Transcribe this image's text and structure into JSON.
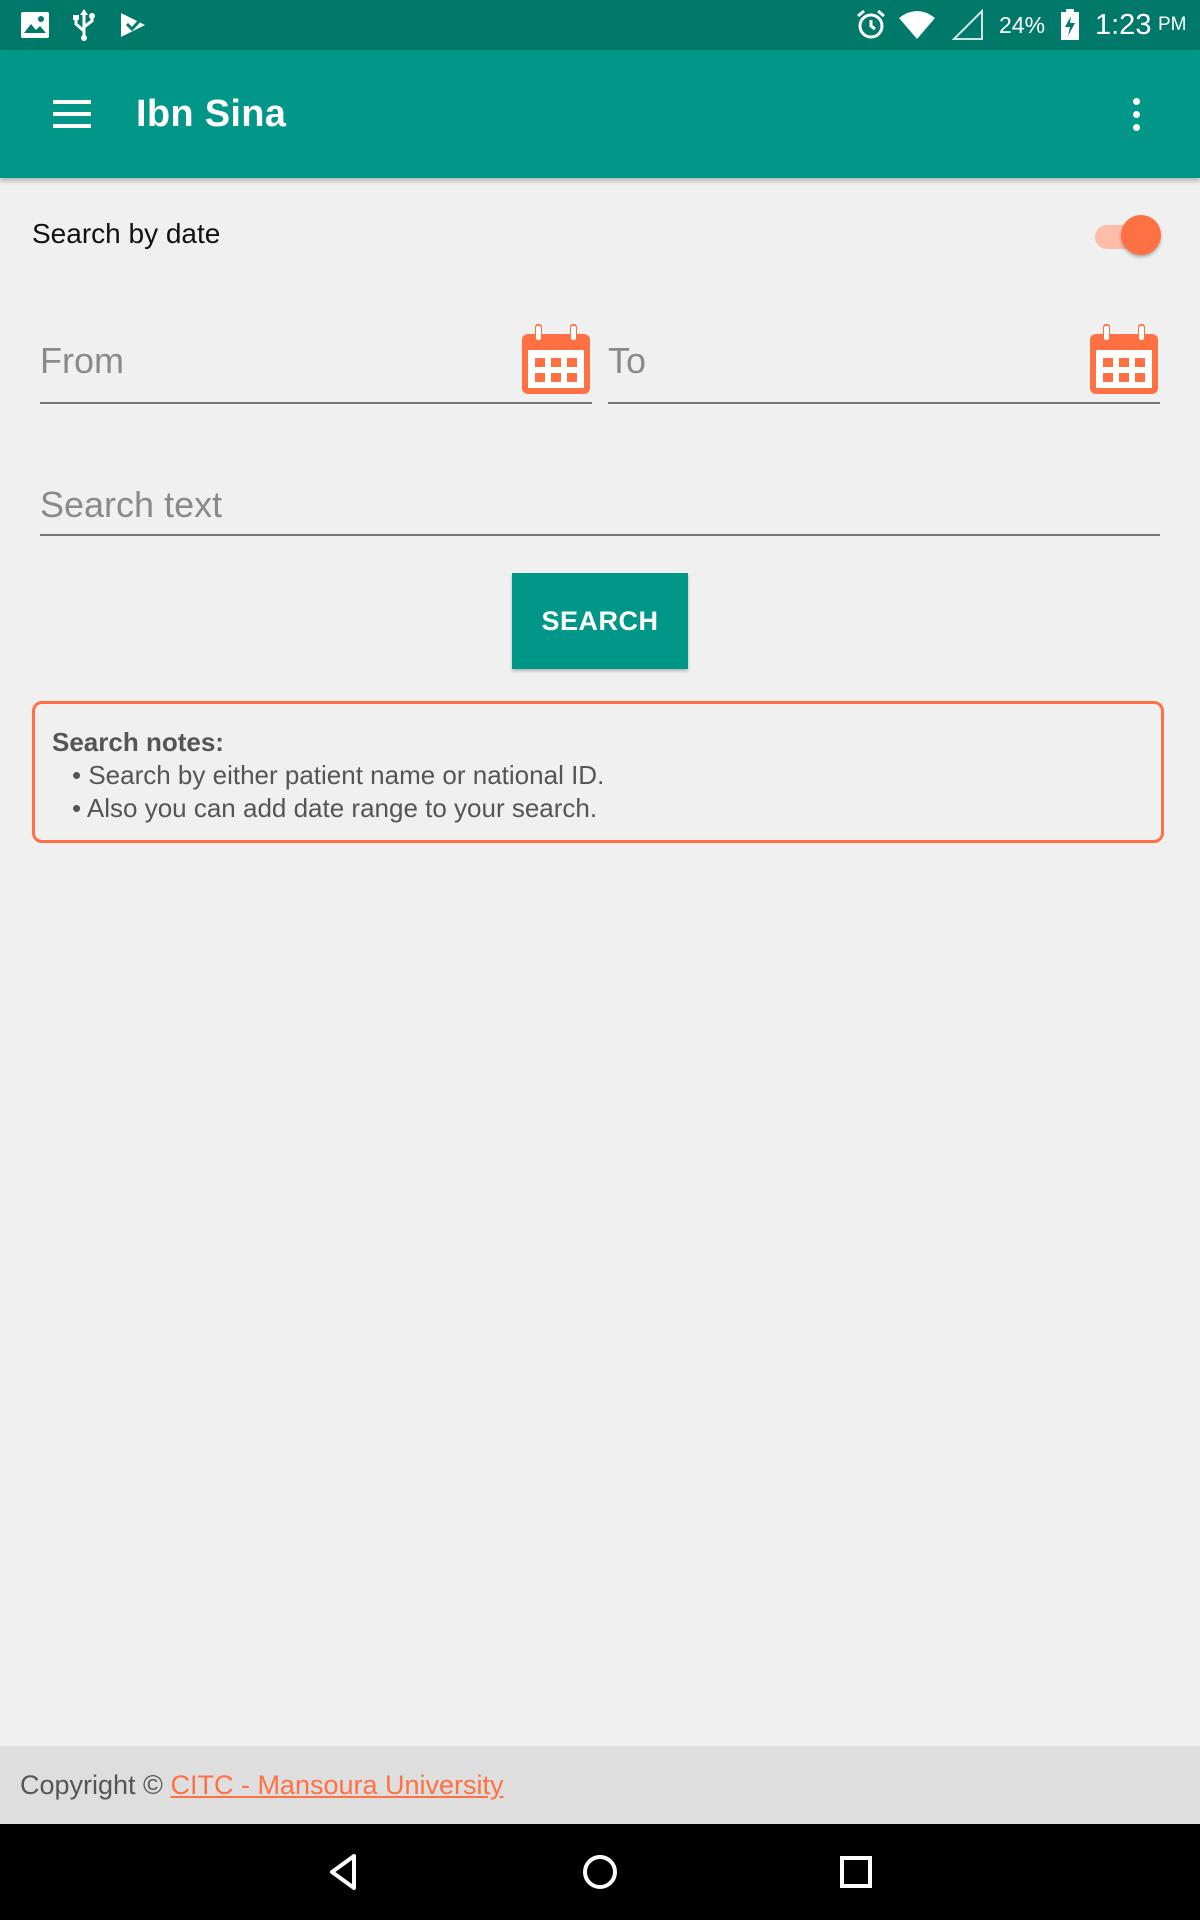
{
  "status_bar": {
    "battery_percent": "24%",
    "time": "1:23",
    "ampm": "PM",
    "icons": [
      "image-icon",
      "usb-icon",
      "play-store-icon",
      "alarm-icon",
      "wifi-icon",
      "signal-icon",
      "battery-charging-icon"
    ]
  },
  "app_bar": {
    "title": "Ibn Sina",
    "menu_icon": "hamburger-menu-icon",
    "overflow_icon": "more-vert-icon"
  },
  "search_by_date": {
    "label": "Search by date",
    "enabled": true
  },
  "from_field": {
    "placeholder": "From",
    "value": "",
    "icon": "calendar-icon"
  },
  "to_field": {
    "placeholder": "To",
    "value": "",
    "icon": "calendar-icon"
  },
  "search_text_field": {
    "placeholder": "Search text",
    "value": ""
  },
  "search_button": {
    "label": "SEARCH"
  },
  "notes": {
    "title": "Search notes:",
    "items": [
      "• Search by either patient name or national ID.",
      "• Also you can add date range to your search."
    ]
  },
  "footer": {
    "prefix": "Copyright © ",
    "link_text": "CITC - Mansoura University"
  },
  "nav_bar": {
    "icons": [
      "back-icon",
      "home-icon",
      "recents-icon"
    ]
  },
  "colors": {
    "primary": "#009688",
    "primary_dark": "#00796b",
    "accent": "#ff7043",
    "background": "#f0f0f0",
    "footer_bg": "#dedede"
  }
}
